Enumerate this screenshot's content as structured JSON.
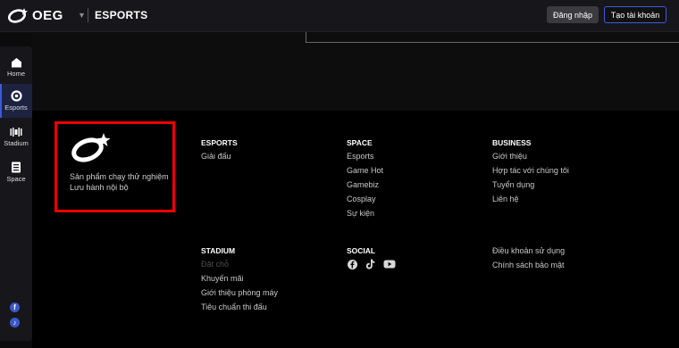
{
  "header": {
    "logo_text": "OEG",
    "section_title": "ESPORTS",
    "login_label": "Đăng nhập",
    "signup_label": "Tạo tài khoản"
  },
  "sidebar": {
    "items": [
      {
        "label": "Home",
        "icon": "home-icon"
      },
      {
        "label": "Esports",
        "icon": "esports-icon",
        "active": true
      },
      {
        "label": "Stadium",
        "icon": "stadium-icon"
      },
      {
        "label": "Space",
        "icon": "space-icon"
      }
    ],
    "social": [
      {
        "icon": "facebook-icon",
        "glyph": "f"
      },
      {
        "icon": "tiktok-icon",
        "glyph": "♪"
      }
    ]
  },
  "footer": {
    "brand_line1": "Sản phẩm chạy thử nghiệm",
    "brand_line2": "Lưu hành nội bộ",
    "esports": {
      "heading": "ESPORTS",
      "links": [
        "Giải đấu"
      ]
    },
    "space": {
      "heading": "SPACE",
      "links": [
        "Esports",
        "Game Hot",
        "Gamebiz",
        "Cosplay",
        "Sự kiện"
      ]
    },
    "business": {
      "heading": "BUSINESS",
      "links": [
        "Giới thiệu",
        "Hợp tác với chúng tôi",
        "Tuyển dụng",
        "Liên hệ"
      ]
    },
    "stadium": {
      "heading": "STADIUM",
      "links": [
        "Đặt chỗ",
        "Khuyến mãi",
        "Giới thiệu phòng máy",
        "Tiêu chuẩn thi đấu"
      ]
    },
    "social": {
      "heading": "SOCIAL",
      "icons": [
        "facebook-icon",
        "tiktok-icon",
        "youtube-icon"
      ]
    },
    "legal": {
      "links": [
        "Điều khoản sử dụng",
        "Chính sách bảo mật"
      ]
    }
  },
  "colors": {
    "accent": "#3a5bdc",
    "highlight_box": "#e00000",
    "background": "#000000"
  }
}
